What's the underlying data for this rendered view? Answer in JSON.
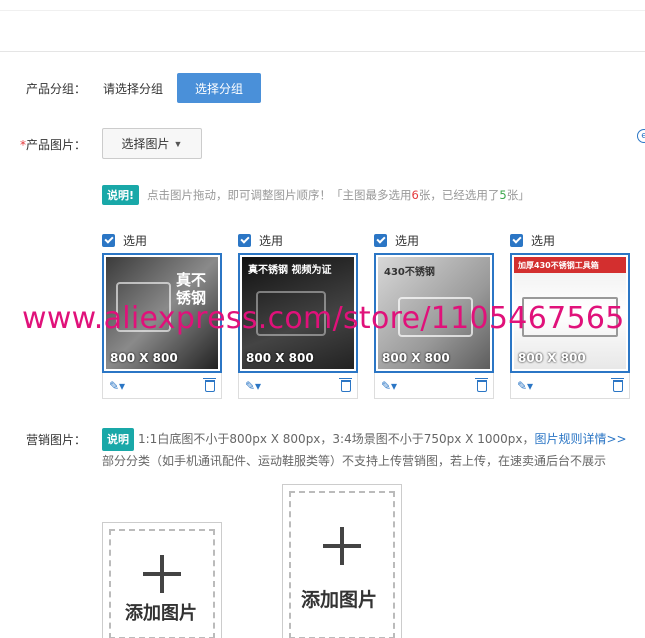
{
  "group": {
    "label": "产品分组：",
    "placeholder": "请选择分组",
    "button": "选择分组"
  },
  "images": {
    "required_mark": "*",
    "label": "产品图片：",
    "select_button": "选择图片"
  },
  "tip": {
    "badge": "说明!",
    "text_before": "点击图片拖动，即可调整图片顺序！「主图最多选用",
    "max": "6",
    "text_mid": "张，已经选用了",
    "used": "5",
    "text_after": "张」"
  },
  "cards": [
    {
      "checkbox_label": "选用",
      "size": "800 X 800",
      "caption": "真不锈钢"
    },
    {
      "checkbox_label": "选用",
      "size": "800 X 800",
      "caption": "真不锈钢 视频为证"
    },
    {
      "checkbox_label": "选用",
      "size": "800 X 800",
      "caption": "430不锈钢"
    },
    {
      "checkbox_label": "选用",
      "size": "800 X 800",
      "caption": "加厚430不锈钢工具箱"
    }
  ],
  "watermark": "www.aliexpress.com/store/1105467565",
  "marketing": {
    "label": "营销图片：",
    "badge": "说明",
    "text1": "1:1白底图不小于800px X 800px，3:4场景图不小于750px X 1000px，",
    "link": "图片规则详情>>",
    "text2": "部分分类（如手机通讯配件、运动鞋服类等）不支持上传营销图，若上传，在速卖通后台不展示"
  },
  "add_images": [
    {
      "label": "添加图片"
    },
    {
      "label": "添加图片"
    }
  ],
  "colors": {
    "primary": "#4a90d9",
    "accent_teal": "#19a8a8",
    "link_blue": "#2b76c5",
    "watermark": "#e0117a"
  }
}
